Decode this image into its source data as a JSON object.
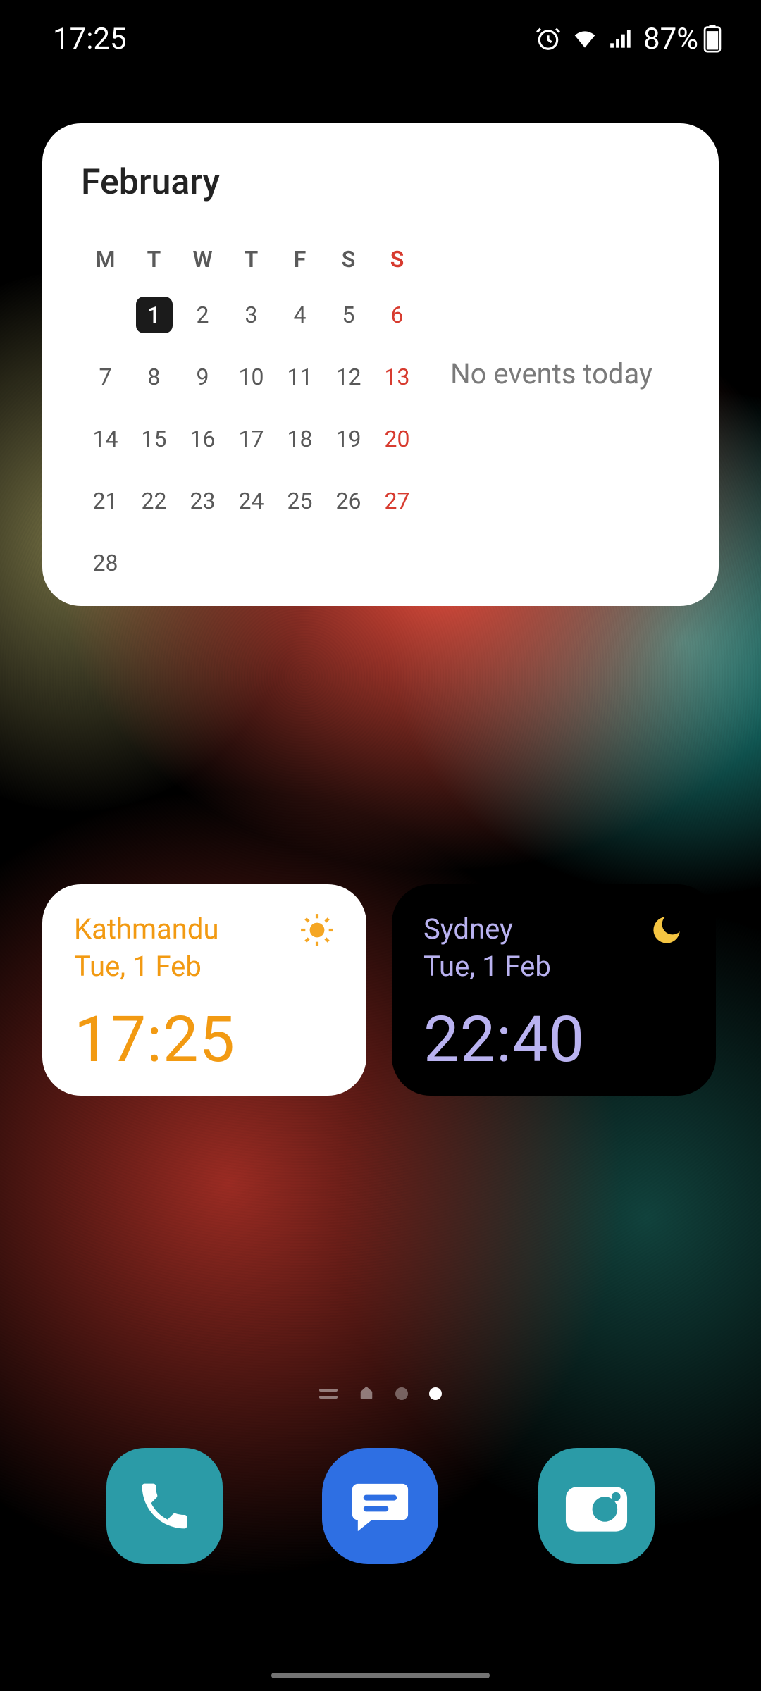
{
  "status": {
    "time": "17:25",
    "battery_percent": "87%",
    "icons": [
      "alarm",
      "wifi",
      "signal",
      "battery"
    ]
  },
  "calendar": {
    "title": "February",
    "day_headers": [
      "M",
      "T",
      "W",
      "T",
      "F",
      "S",
      "S"
    ],
    "weeks": [
      [
        "",
        "1",
        "2",
        "3",
        "4",
        "5",
        "6"
      ],
      [
        "7",
        "8",
        "9",
        "10",
        "11",
        "12",
        "13"
      ],
      [
        "14",
        "15",
        "16",
        "17",
        "18",
        "19",
        "20"
      ],
      [
        "21",
        "22",
        "23",
        "24",
        "25",
        "26",
        "27"
      ],
      [
        "28",
        "",
        "",
        "",
        "",
        "",
        ""
      ]
    ],
    "today": "1",
    "events_text": "No events today"
  },
  "clocks": [
    {
      "city": "Kathmandu",
      "date": "Tue, 1 Feb",
      "time": "17:25",
      "theme": "light",
      "icon": "sun"
    },
    {
      "city": "Sydney",
      "date": "Tue, 1 Feb",
      "time": "22:40",
      "theme": "dark",
      "icon": "moon"
    }
  ],
  "page_indicator": {
    "count": 4,
    "active": 3
  },
  "dock": [
    {
      "name": "phone",
      "icon": "phone"
    },
    {
      "name": "messages",
      "icon": "messages"
    },
    {
      "name": "camera",
      "icon": "camera"
    }
  ]
}
